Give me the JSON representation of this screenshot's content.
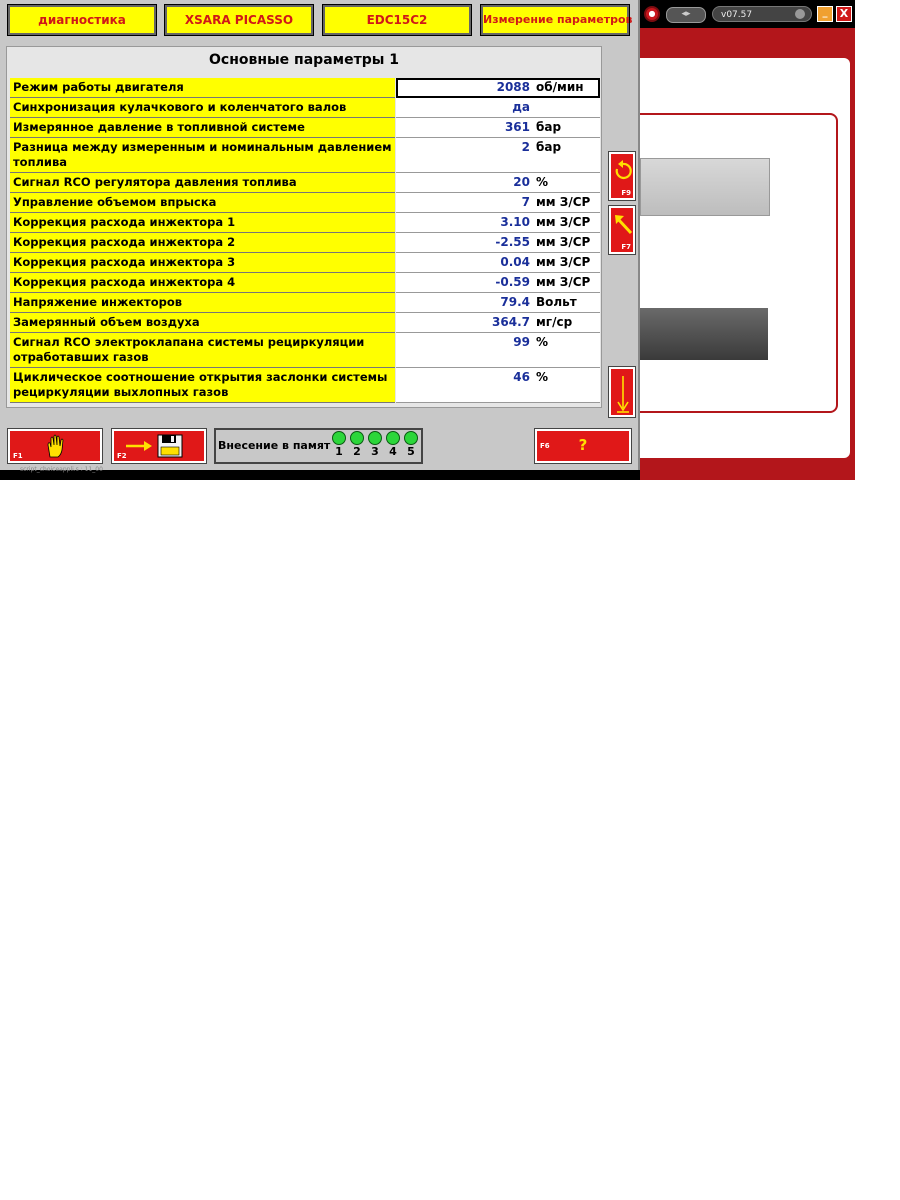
{
  "tabs": [
    {
      "label": "диагностика"
    },
    {
      "label": "XSARA PICASSO"
    },
    {
      "label": "EDC15C2"
    },
    {
      "label": "Измерение параметров"
    }
  ],
  "panel": {
    "title": "Основные параметры 1",
    "rows": [
      {
        "label": "Режим работы двигателя",
        "value": "2088",
        "unit": "об/мин",
        "selected": true
      },
      {
        "label": "Синхронизация кулачкового и коленчатого валов",
        "value": "да",
        "unit": ""
      },
      {
        "label": "Измерянное давление в топливной системе",
        "value": "361",
        "unit": "бар"
      },
      {
        "label": "Разница между измеренным и номинальным давлением топлива",
        "value": "2",
        "unit": "бар"
      },
      {
        "label": "Сигнал RCO регулятора давления топлива",
        "value": "20",
        "unit": "%"
      },
      {
        "label": "Управление объемом впрыска",
        "value": "7",
        "unit": "мм З/СР"
      },
      {
        "label": "Коррекция расхода инжектора 1",
        "value": "3.10",
        "unit": "мм З/СР"
      },
      {
        "label": "Коррекция расхода инжектора 2",
        "value": "-2.55",
        "unit": "мм З/СР"
      },
      {
        "label": "Коррекция расхода инжектора 3",
        "value": "0.04",
        "unit": "мм З/СР"
      },
      {
        "label": "Коррекция расхода инжектора 4",
        "value": "-0.59",
        "unit": "мм З/СР"
      },
      {
        "label": "Напряжение инжекторов",
        "value": "79.4",
        "unit": "Вольт"
      },
      {
        "label": "Замерянный объем воздуха",
        "value": "364.7",
        "unit": "мг/ср"
      },
      {
        "label": "Сигнал RCO электроклапана системы рециркуляции отработавших газов",
        "value": "99",
        "unit": "%"
      },
      {
        "label": "Циклическое соотношение открытия заслонки системы рециркуляции выхлопных газов",
        "value": "46",
        "unit": "%"
      }
    ]
  },
  "side_keys": {
    "f9": "F9",
    "f7": "F7"
  },
  "bottom": {
    "f1": "F1",
    "f2": "F2",
    "memory_label": "Внесение в памят",
    "memory_slots": [
      "1",
      "2",
      "3",
      "4",
      "5"
    ],
    "f6": "F6",
    "f6_symbol": "?"
  },
  "window": {
    "version": "v07.57",
    "min_symbol": "_",
    "close_symbol": "X"
  },
  "status": {
    "script_path": "script_choiceappli.s : 11_00"
  },
  "colors": {
    "accent_red": "#e01818",
    "label_yellow": "#ffff00",
    "value_blue": "#1a2f9a",
    "led_green": "#2cd63a"
  }
}
